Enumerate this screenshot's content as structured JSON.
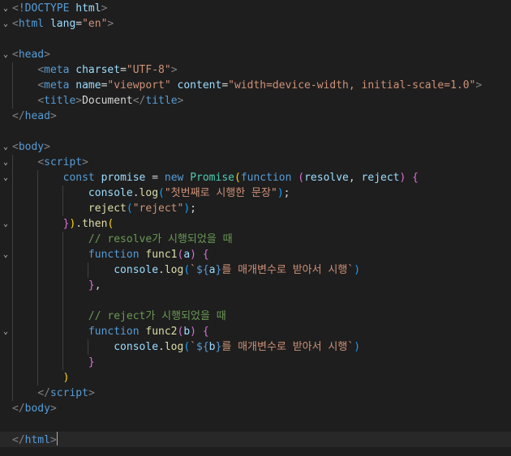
{
  "editor": {
    "lines": [
      [
        [
          "brk",
          "<"
        ],
        [
          "tag",
          "!DOCTYPE "
        ],
        [
          "attr",
          "html"
        ],
        [
          "brk",
          ">"
        ]
      ],
      [
        [
          "brk",
          "<"
        ],
        [
          "tag",
          "html "
        ],
        [
          "attr",
          "lang"
        ],
        [
          "pun",
          "="
        ],
        [
          "str",
          "\"en\""
        ],
        [
          "brk",
          ">"
        ]
      ],
      [],
      [
        [
          "brk",
          "<"
        ],
        [
          "tag",
          "head"
        ],
        [
          "brk",
          ">"
        ]
      ],
      [
        [
          "txt",
          "    "
        ],
        [
          "brk",
          "<"
        ],
        [
          "tag",
          "meta "
        ],
        [
          "attr",
          "charset"
        ],
        [
          "pun",
          "="
        ],
        [
          "str",
          "\"UTF-8\""
        ],
        [
          "brk",
          ">"
        ]
      ],
      [
        [
          "txt",
          "    "
        ],
        [
          "brk",
          "<"
        ],
        [
          "tag",
          "meta "
        ],
        [
          "attr",
          "name"
        ],
        [
          "pun",
          "="
        ],
        [
          "str",
          "\"viewport\" "
        ],
        [
          "attr",
          "content"
        ],
        [
          "pun",
          "="
        ],
        [
          "str",
          "\"width=device-width, initial-scale=1.0\""
        ],
        [
          "brk",
          ">"
        ]
      ],
      [
        [
          "txt",
          "    "
        ],
        [
          "brk",
          "<"
        ],
        [
          "tag",
          "title"
        ],
        [
          "brk",
          ">"
        ],
        [
          "txt",
          "Document"
        ],
        [
          "brk",
          "</"
        ],
        [
          "tag",
          "title"
        ],
        [
          "brk",
          ">"
        ]
      ],
      [
        [
          "brk",
          "</"
        ],
        [
          "tag",
          "head"
        ],
        [
          "brk",
          ">"
        ]
      ],
      [],
      [
        [
          "brk",
          "<"
        ],
        [
          "tag",
          "body"
        ],
        [
          "brk",
          ">"
        ]
      ],
      [
        [
          "txt",
          "    "
        ],
        [
          "brk",
          "<"
        ],
        [
          "tag",
          "script"
        ],
        [
          "brk",
          ">"
        ]
      ],
      [
        [
          "txt",
          "        "
        ],
        [
          "kw",
          "const "
        ],
        [
          "var",
          "promise "
        ],
        [
          "pun",
          "= "
        ],
        [
          "kw",
          "new "
        ],
        [
          "cls",
          "Promise"
        ],
        [
          "b1",
          "("
        ],
        [
          "kw",
          "function "
        ],
        [
          "b2",
          "("
        ],
        [
          "var",
          "resolve"
        ],
        [
          "pun",
          ", "
        ],
        [
          "var",
          "reject"
        ],
        [
          "b2",
          ")"
        ],
        [
          "pun",
          " "
        ],
        [
          "b2",
          "{"
        ]
      ],
      [
        [
          "txt",
          "            "
        ],
        [
          "var",
          "console"
        ],
        [
          "pun",
          "."
        ],
        [
          "fn",
          "log"
        ],
        [
          "b3",
          "("
        ],
        [
          "str",
          "\"첫번째로 시행한 문장\""
        ],
        [
          "b3",
          ")"
        ],
        [
          "pun",
          ";"
        ]
      ],
      [
        [
          "txt",
          "            "
        ],
        [
          "fn",
          "reject"
        ],
        [
          "b3",
          "("
        ],
        [
          "str",
          "\"reject\""
        ],
        [
          "b3",
          ")"
        ],
        [
          "pun",
          ";"
        ]
      ],
      [
        [
          "txt",
          "        "
        ],
        [
          "b2",
          "}"
        ],
        [
          "b1",
          ")"
        ],
        [
          "pun",
          "."
        ],
        [
          "fn",
          "then"
        ],
        [
          "b1",
          "("
        ]
      ],
      [
        [
          "txt",
          "            "
        ],
        [
          "cmt",
          "// resolve가 시행되었을 때"
        ]
      ],
      [
        [
          "txt",
          "            "
        ],
        [
          "kw",
          "function "
        ],
        [
          "fn",
          "func1"
        ],
        [
          "b2",
          "("
        ],
        [
          "var",
          "a"
        ],
        [
          "b2",
          ")"
        ],
        [
          "pun",
          " "
        ],
        [
          "b2",
          "{"
        ]
      ],
      [
        [
          "txt",
          "                "
        ],
        [
          "var",
          "console"
        ],
        [
          "pun",
          "."
        ],
        [
          "fn",
          "log"
        ],
        [
          "b3",
          "("
        ],
        [
          "str",
          "`"
        ],
        [
          "kw",
          "${"
        ],
        [
          "var",
          "a"
        ],
        [
          "kw",
          "}"
        ],
        [
          "str",
          "를 매개변수로 받아서 시행`"
        ],
        [
          "b3",
          ")"
        ]
      ],
      [
        [
          "txt",
          "            "
        ],
        [
          "b2",
          "}"
        ],
        [
          "pun",
          ","
        ]
      ],
      [],
      [
        [
          "txt",
          "            "
        ],
        [
          "cmt",
          "// reject가 시행되었을 때"
        ]
      ],
      [
        [
          "txt",
          "            "
        ],
        [
          "kw",
          "function "
        ],
        [
          "fn",
          "func2"
        ],
        [
          "b2",
          "("
        ],
        [
          "var",
          "b"
        ],
        [
          "b2",
          ")"
        ],
        [
          "pun",
          " "
        ],
        [
          "b2",
          "{"
        ]
      ],
      [
        [
          "txt",
          "                "
        ],
        [
          "var",
          "console"
        ],
        [
          "pun",
          "."
        ],
        [
          "fn",
          "log"
        ],
        [
          "b3",
          "("
        ],
        [
          "str",
          "`"
        ],
        [
          "kw",
          "${"
        ],
        [
          "var",
          "b"
        ],
        [
          "kw",
          "}"
        ],
        [
          "str",
          "를 매개변수로 받아서 시행`"
        ],
        [
          "b3",
          ")"
        ]
      ],
      [
        [
          "txt",
          "            "
        ],
        [
          "b2",
          "}"
        ]
      ],
      [
        [
          "txt",
          "        "
        ],
        [
          "b1",
          ")"
        ]
      ],
      [
        [
          "txt",
          "    "
        ],
        [
          "brk",
          "</"
        ],
        [
          "tag",
          "script"
        ],
        [
          "brk",
          ">"
        ]
      ],
      [
        [
          "brk",
          "</"
        ],
        [
          "tag",
          "body"
        ],
        [
          "brk",
          ">"
        ]
      ],
      [],
      [
        [
          "brk",
          "</"
        ],
        [
          "tag",
          "html"
        ],
        [
          "brk",
          ">"
        ],
        [
          "cursor",
          ""
        ]
      ]
    ],
    "fold_markers": [
      0,
      1,
      3,
      9,
      10,
      11,
      14,
      16,
      21
    ],
    "current_line": 28,
    "fold_glyph": "⌄"
  }
}
